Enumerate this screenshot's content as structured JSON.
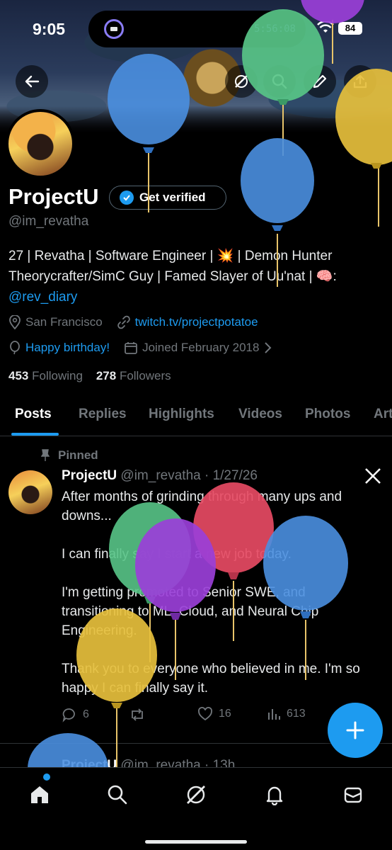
{
  "status_bar": {
    "time": "9:05",
    "island_timer": "5:56:08",
    "battery": "84"
  },
  "header": {
    "back_icon": "arrow-left-icon",
    "grok_icon": "grok-icon",
    "search_icon": "search-icon",
    "edit_icon": "pencil-icon",
    "share_icon": "share-icon"
  },
  "profile": {
    "name": "ProjectU",
    "verify_label": "Get verified",
    "handle": "@im_revatha",
    "bio_line1": "27 | Revatha | Software Engineer | 💥 | Demon Hunter",
    "bio_line2": "Theorycrafter/SimC Guy | Famed Slayer of Uu'nat | 🧠:",
    "bio_link": "@rev_diary",
    "location": "San Francisco",
    "website": "twitch.tv/projectpotatoe",
    "birthday": "Happy birthday!",
    "joined": "Joined February 2018",
    "following_count": "453",
    "following_label": "Following",
    "followers_count": "278",
    "followers_label": "Followers"
  },
  "tabs": [
    "Posts",
    "Replies",
    "Highlights",
    "Videos",
    "Photos",
    "Art"
  ],
  "post": {
    "pinned_label": "Pinned",
    "author": "ProjectU",
    "handle_date": "@im_revatha · 1/27/26",
    "paragraphs": [
      "After months of grinding through many ups and downs...",
      "I can finally say I start a new job today.",
      "I'm getting promoted to Senior SWE, and transitioning to ML, Cloud, and Neural Chip Engineering.",
      "Thank you to everyone who believed in me. I'm so happy I can finally say it."
    ],
    "replies": "6",
    "reposts": "",
    "likes": "16",
    "views": "613"
  },
  "next_post": {
    "author": "ProjectU",
    "meta": "@im_revatha · 13h"
  },
  "colors": {
    "accent": "#1d9bf0",
    "muted": "#71767b",
    "background": "#000000"
  }
}
